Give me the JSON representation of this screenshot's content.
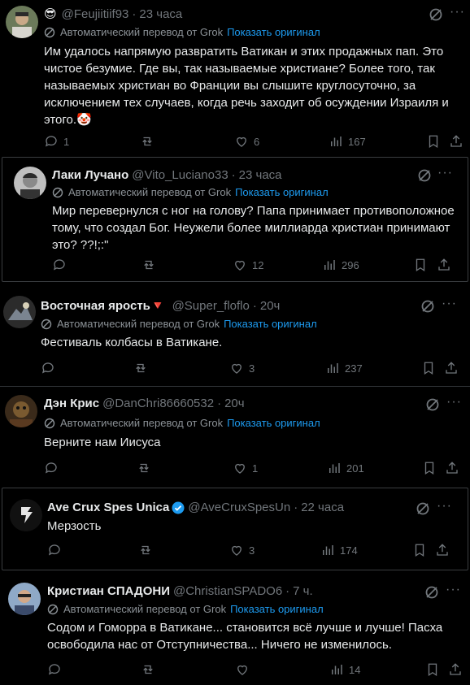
{
  "translate_label": "Автоматический перевод от Grok",
  "show_original": "Показать оригинал",
  "tweets": [
    {
      "name": "",
      "handle": "@Feujiitiif93",
      "time": "23 часа",
      "text": "Им удалось напрямую развратить Ватикан и этих продажных пап. Это чистое безумие. Где вы, так называемые христиане? Более того, так называемых христиан во Франции вы слышите круглосуточно, за исключением тех случаев, когда речь заходит об осуждении Израиля и этого.🤡",
      "replies": "1",
      "likes": "6",
      "views": "167"
    },
    {
      "name": "Лаки Лучано",
      "handle": "@Vito_Luciano33",
      "time": "23 часа",
      "text": "Мир перевернулся с ног на голову? Папа принимает противоположное тому, что создал Бог. Неужели более миллиарда христиан принимают это? ??!;:\"",
      "likes": "12",
      "views": "296"
    },
    {
      "name": "Восточная ярость🔻",
      "handle": "@Super_floflo",
      "time": "20ч",
      "text": "Фестиваль колбасы в Ватикане.",
      "likes": "3",
      "views": "237"
    },
    {
      "name": "Дэн Крис",
      "handle": "@DanChri86660532",
      "time": "20ч",
      "text": "Верните нам Иисуса",
      "likes": "1",
      "views": "201"
    },
    {
      "name": "Ave Crux Spes Unica",
      "handle": "@AveCruxSpesUn",
      "time": "22 часа",
      "text": "Мерзость",
      "likes": "3",
      "views": "174"
    },
    {
      "name": "Кристиан СПАДОНИ",
      "handle": "@ChristianSPADO6",
      "time": "7 ч.",
      "text": "Содом и Гоморра в Ватикане... становится всё лучше и лучше! Пасха освободила нас от Отступничества... Ничего не изменилось.",
      "views": "14"
    }
  ]
}
